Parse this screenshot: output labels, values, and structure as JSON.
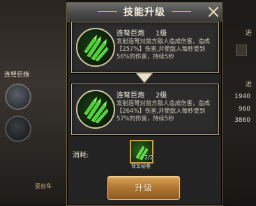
{
  "dialog": {
    "title": "技能升级",
    "close_icon": "close-icon"
  },
  "current_skill": {
    "name": "连弩巨炮",
    "level": "1级",
    "description": "发射连弩对前方敌人造成伤害，造成【257%】伤害,并使敌人每秒受到56%的伤害，持续5秒",
    "icon": "arrow-volley-icon"
  },
  "next_skill": {
    "name": "连弩巨炮",
    "level": "2级",
    "description": "发射连弩对前方敌人造成伤害，造成【264%】伤害,并使敌人每秒受到57%的伤害，持续5秒",
    "icon": "arrow-volley-icon"
  },
  "cost": {
    "label": "消耗:",
    "item_name": "弩车秘卷",
    "item_count": "2/2",
    "item_icon": "scroll-icon"
  },
  "actions": {
    "upgrade_label": "升级"
  },
  "background": {
    "left_skill_label": "连弩巨炮",
    "left_badge": "亚台车",
    "right_tag": "进",
    "right_values": [
      "1940",
      "960",
      "3860"
    ]
  },
  "colors": {
    "panel_border": "#bfae8a",
    "button_gold": "#b47a34",
    "skill_green": "#3dd62a"
  }
}
